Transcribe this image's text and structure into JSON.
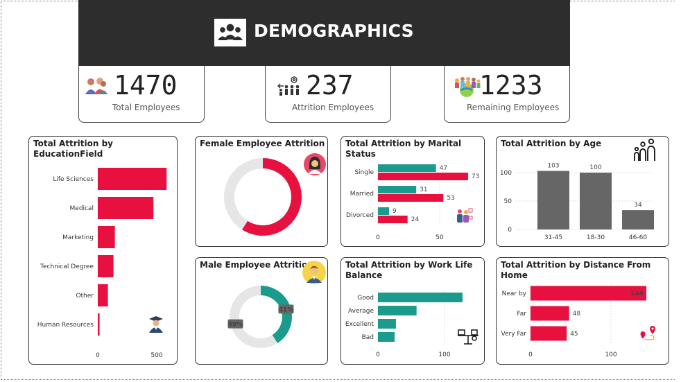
{
  "header": {
    "title": "DEMOGRAPHICS",
    "icon": "group-people-icon"
  },
  "kpis": [
    {
      "value": "1470",
      "label": "Total Employees",
      "icon": "people-icon"
    },
    {
      "value": "237",
      "label": "Attrition Employees",
      "icon": "people-leaving-icon"
    },
    {
      "value": "1233",
      "label": "Remaining Employees",
      "icon": "crowd-globe-icon"
    }
  ],
  "colors": {
    "red": "#e8103f",
    "teal": "#1a9b8e",
    "gray": "#666666",
    "lightgray": "#e6e6e6",
    "dark": "#2d2d2d"
  },
  "charts": {
    "education": {
      "title": "Total Attrition by EducationField"
    },
    "female": {
      "title": "Female Employee Attrition"
    },
    "male": {
      "title": "Male Employee Attrition"
    },
    "marital": {
      "title": "Total Attrition by Marital Status"
    },
    "age": {
      "title": "Total Attrition by Age"
    },
    "worklife": {
      "title": "Total Attrition by Work Life Balance"
    },
    "distance": {
      "title": "Total Attrition by Distance From Home"
    }
  },
  "chart_data": [
    {
      "id": "education",
      "type": "bar",
      "orientation": "horizontal",
      "categories": [
        "Life Sciences",
        "Medical",
        "Marketing",
        "Technical Degree",
        "Other",
        "Human Resources"
      ],
      "values": [
        584,
        472,
        145,
        133,
        86,
        15
      ],
      "xticks": [
        "0",
        "500"
      ],
      "xlim": [
        0,
        650
      ]
    },
    {
      "id": "female",
      "type": "pie",
      "style": "donut",
      "slices": [
        {
          "value": 0.59,
          "color": "#e8103f"
        },
        {
          "value": 0.41,
          "color": "#e6e6e6"
        }
      ]
    },
    {
      "id": "male",
      "type": "pie",
      "style": "donut",
      "slices": [
        {
          "label": "41%",
          "value": 41,
          "color": "#1a9b8e"
        },
        {
          "label": "59%",
          "value": 59,
          "color": "#e6e6e6"
        }
      ]
    },
    {
      "id": "marital",
      "type": "bar",
      "orientation": "horizontal",
      "grouped": true,
      "categories": [
        "Single",
        "Married",
        "Divorced"
      ],
      "series": [
        {
          "values": [
            47,
            31,
            9
          ],
          "color": "#1a9b8e"
        },
        {
          "values": [
            73,
            53,
            24
          ],
          "color": "#e8103f"
        }
      ],
      "xticks": [
        "0",
        "50"
      ],
      "xlim": [
        0,
        80
      ]
    },
    {
      "id": "age",
      "type": "bar",
      "orientation": "vertical",
      "categories": [
        "31-45",
        "18-30",
        "46-60"
      ],
      "values": [
        103,
        100,
        34
      ],
      "yticks": [
        "0",
        "50",
        "100"
      ],
      "ylim": [
        0,
        120
      ]
    },
    {
      "id": "worklife",
      "type": "bar",
      "orientation": "horizontal",
      "categories": [
        "Good",
        "Average",
        "Excellent",
        "Bad"
      ],
      "values": [
        127,
        58,
        27,
        25
      ],
      "xticks": [
        "0",
        "100"
      ],
      "xlim": [
        0,
        150
      ]
    },
    {
      "id": "distance",
      "type": "bar",
      "orientation": "horizontal",
      "categories": [
        "Near by",
        "Far",
        "Very Far"
      ],
      "values": [
        144,
        48,
        45
      ],
      "xticks": [
        "0",
        "100"
      ],
      "xlim": [
        0,
        150
      ]
    }
  ]
}
